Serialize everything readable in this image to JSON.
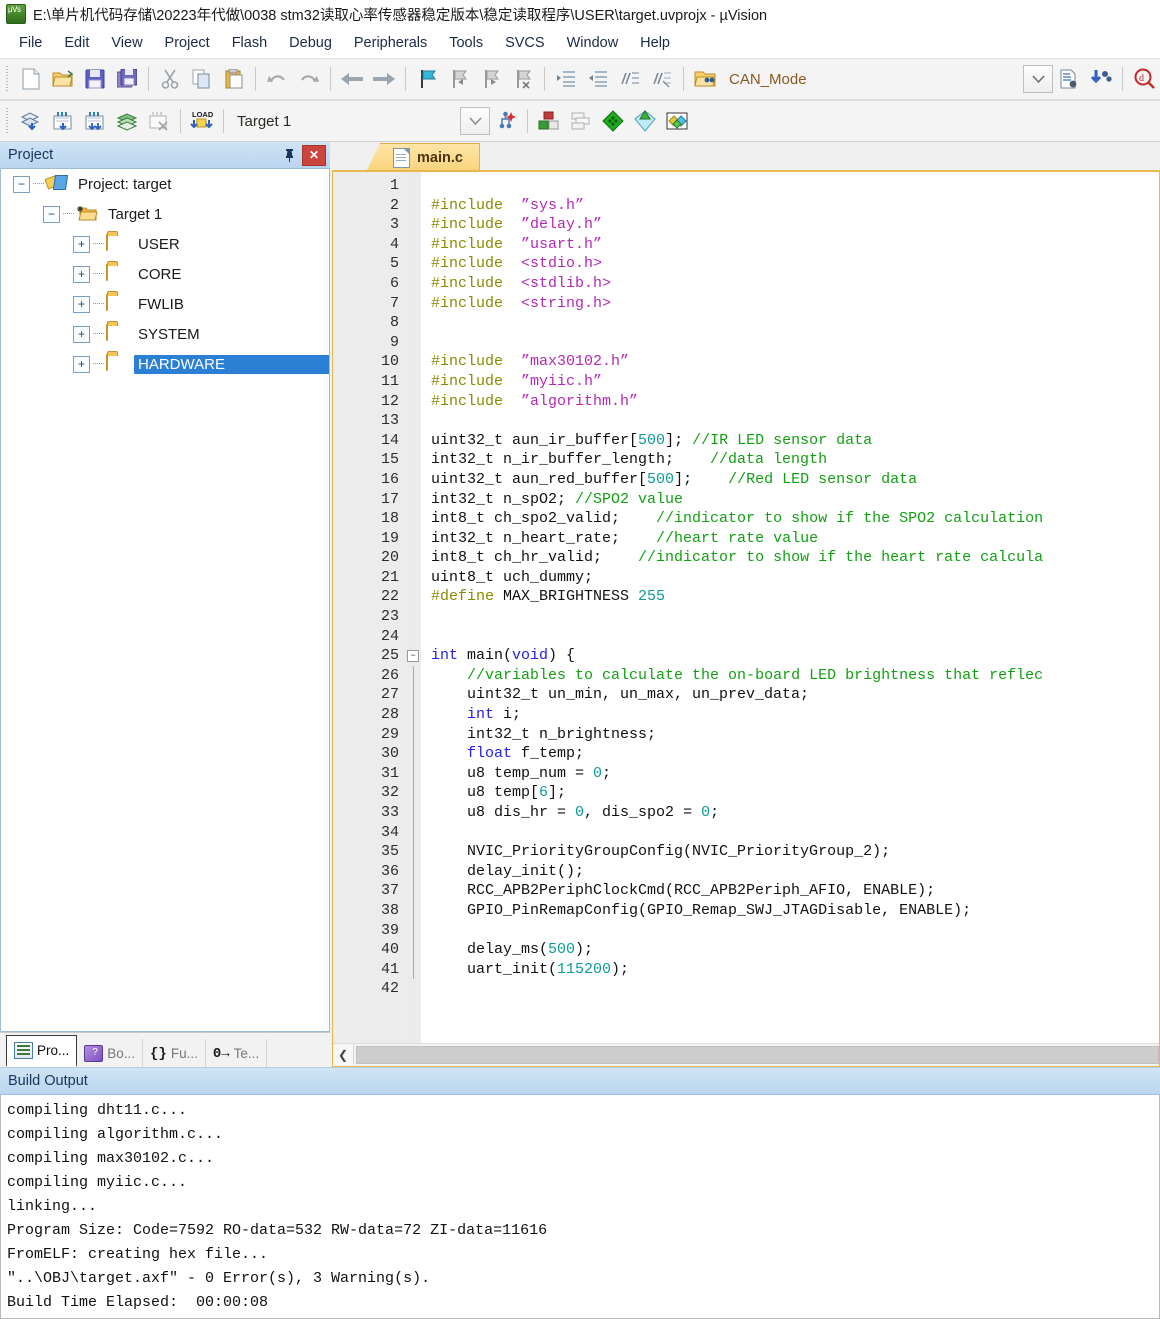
{
  "window": {
    "title": "E:\\单片机代码存储\\20223年代做\\0038 stm32读取心率传感器稳定版本\\稳定读取程序\\USER\\target.uvprojx - µVision",
    "app_icon": "uvision-logo-icon"
  },
  "menubar": {
    "items": [
      "File",
      "Edit",
      "View",
      "Project",
      "Flash",
      "Debug",
      "Peripherals",
      "Tools",
      "SVCS",
      "Window",
      "Help"
    ]
  },
  "toolbar_main": {
    "icons": [
      "new-file-icon",
      "open-file-icon",
      "save-icon",
      "save-all-icon",
      "cut-icon",
      "copy-icon",
      "paste-icon",
      "undo-icon",
      "redo-icon",
      "navigate-back-icon",
      "navigate-forward-icon",
      "bookmark-toggle-icon",
      "bookmark-prev-icon",
      "bookmark-next-icon",
      "bookmark-clear-icon",
      "indent-right-icon",
      "indent-left-icon",
      "comment-icon",
      "uncomment-icon",
      "open-folder-config-icon"
    ],
    "mode_label": "CAN_Mode",
    "right_icons": [
      "dropdown-arrow-icon",
      "file-properties-icon",
      "insert-symbol-icon",
      "find-in-files-icon"
    ]
  },
  "toolbar_build": {
    "icons": [
      "translate-file-icon",
      "build-target-icon",
      "rebuild-all-icon",
      "batch-build-icon",
      "stop-build-icon",
      "download-load-icon"
    ],
    "target_label": "Target 1",
    "right_icons": [
      "target-dropdown-icon",
      "target-options-icon",
      "manage-project-items-icon",
      "multi-project-icon",
      "pack-installer-icon",
      "manage-run-time-env-icon",
      "select-software-packs-icon"
    ]
  },
  "project_panel": {
    "header": "Project",
    "pin_icon": "pin-icon",
    "close_icon": "close-icon",
    "tree": [
      {
        "label": "Project: target",
        "icon": "project-icon",
        "expander": "−",
        "depth": 0,
        "selected": false
      },
      {
        "label": "Target 1",
        "icon": "target-folder-icon",
        "expander": "−",
        "depth": 1,
        "selected": false
      },
      {
        "label": "USER",
        "icon": "folder-icon",
        "expander": "+",
        "depth": 2,
        "selected": false
      },
      {
        "label": "CORE",
        "icon": "folder-icon",
        "expander": "+",
        "depth": 2,
        "selected": false
      },
      {
        "label": "FWLIB",
        "icon": "folder-icon",
        "expander": "+",
        "depth": 2,
        "selected": false
      },
      {
        "label": "SYSTEM",
        "icon": "folder-icon",
        "expander": "+",
        "depth": 2,
        "selected": false
      },
      {
        "label": "HARDWARE",
        "icon": "folder-icon",
        "expander": "+",
        "depth": 2,
        "selected": true
      }
    ],
    "tabs": [
      {
        "label": "Pro...",
        "icon": "project-view-icon",
        "active": true
      },
      {
        "label": "Bo...",
        "icon": "books-view-icon",
        "active": false
      },
      {
        "label": "Fu...",
        "icon": "functions-view-icon",
        "active": false
      },
      {
        "label": "Te...",
        "icon": "templates-view-icon",
        "active": false
      }
    ]
  },
  "editor": {
    "tab": {
      "label": "main.c",
      "icon": "c-file-icon"
    },
    "first_line": 1,
    "fold_markers": {
      "25": "−"
    },
    "lines": [
      {
        "n": 1,
        "tokens": []
      },
      {
        "n": 2,
        "tokens": [
          [
            "pre",
            "#include"
          ],
          [
            "txt",
            "  "
          ],
          [
            "str",
            "”sys.h”"
          ]
        ]
      },
      {
        "n": 3,
        "tokens": [
          [
            "pre",
            "#include"
          ],
          [
            "txt",
            "  "
          ],
          [
            "str",
            "”delay.h”"
          ]
        ]
      },
      {
        "n": 4,
        "tokens": [
          [
            "pre",
            "#include"
          ],
          [
            "txt",
            "  "
          ],
          [
            "str",
            "”usart.h”"
          ]
        ]
      },
      {
        "n": 5,
        "tokens": [
          [
            "pre",
            "#include"
          ],
          [
            "txt",
            "  "
          ],
          [
            "str",
            "<stdio.h>"
          ]
        ]
      },
      {
        "n": 6,
        "tokens": [
          [
            "pre",
            "#include"
          ],
          [
            "txt",
            "  "
          ],
          [
            "str",
            "<stdlib.h>"
          ]
        ]
      },
      {
        "n": 7,
        "tokens": [
          [
            "pre",
            "#include"
          ],
          [
            "txt",
            "  "
          ],
          [
            "str",
            "<string.h>"
          ]
        ]
      },
      {
        "n": 8,
        "tokens": []
      },
      {
        "n": 9,
        "tokens": []
      },
      {
        "n": 10,
        "tokens": [
          [
            "pre",
            "#include"
          ],
          [
            "txt",
            "  "
          ],
          [
            "str",
            "”max30102.h”"
          ]
        ]
      },
      {
        "n": 11,
        "tokens": [
          [
            "pre",
            "#include"
          ],
          [
            "txt",
            "  "
          ],
          [
            "str",
            "”myiic.h”"
          ]
        ]
      },
      {
        "n": 12,
        "tokens": [
          [
            "pre",
            "#include"
          ],
          [
            "txt",
            "  "
          ],
          [
            "str",
            "”algorithm.h”"
          ]
        ]
      },
      {
        "n": 13,
        "tokens": []
      },
      {
        "n": 14,
        "tokens": [
          [
            "txt",
            "uint32_t aun_ir_buffer["
          ],
          [
            "num",
            "500"
          ],
          [
            "txt",
            "]; "
          ],
          [
            "cmt",
            "//IR LED sensor data"
          ]
        ]
      },
      {
        "n": 15,
        "tokens": [
          [
            "txt",
            "int32_t n_ir_buffer_length;    "
          ],
          [
            "cmt",
            "//data length"
          ]
        ]
      },
      {
        "n": 16,
        "tokens": [
          [
            "txt",
            "uint32_t aun_red_buffer["
          ],
          [
            "num",
            "500"
          ],
          [
            "txt",
            "];    "
          ],
          [
            "cmt",
            "//Red LED sensor data"
          ]
        ]
      },
      {
        "n": 17,
        "tokens": [
          [
            "txt",
            "int32_t n_spO2; "
          ],
          [
            "cmt",
            "//SPO2 value"
          ]
        ]
      },
      {
        "n": 18,
        "tokens": [
          [
            "txt",
            "int8_t ch_spo2_valid;    "
          ],
          [
            "cmt",
            "//indicator to show if the SPO2 calculation"
          ]
        ]
      },
      {
        "n": 19,
        "tokens": [
          [
            "txt",
            "int32_t n_heart_rate;    "
          ],
          [
            "cmt",
            "//heart rate value"
          ]
        ]
      },
      {
        "n": 20,
        "tokens": [
          [
            "txt",
            "int8_t ch_hr_valid;    "
          ],
          [
            "cmt",
            "//indicator to show if the heart rate calcula"
          ]
        ]
      },
      {
        "n": 21,
        "tokens": [
          [
            "txt",
            "uint8_t uch_dummy;"
          ]
        ]
      },
      {
        "n": 22,
        "tokens": [
          [
            "pre",
            "#define"
          ],
          [
            "txt",
            " MAX_BRIGHTNESS "
          ],
          [
            "num",
            "255"
          ]
        ]
      },
      {
        "n": 23,
        "tokens": []
      },
      {
        "n": 24,
        "tokens": []
      },
      {
        "n": 25,
        "tokens": [
          [
            "kw",
            "int"
          ],
          [
            "txt",
            " main("
          ],
          [
            "kw",
            "void"
          ],
          [
            "txt",
            ") {"
          ]
        ]
      },
      {
        "n": 26,
        "tokens": [
          [
            "txt",
            "    "
          ],
          [
            "cmt",
            "//variables to calculate the on-board LED brightness that reflec"
          ]
        ]
      },
      {
        "n": 27,
        "tokens": [
          [
            "txt",
            "    uint32_t un_min, un_max, un_prev_data;"
          ]
        ]
      },
      {
        "n": 28,
        "tokens": [
          [
            "txt",
            "    "
          ],
          [
            "kw",
            "int"
          ],
          [
            "txt",
            " i;"
          ]
        ]
      },
      {
        "n": 29,
        "tokens": [
          [
            "txt",
            "    int32_t n_brightness;"
          ]
        ]
      },
      {
        "n": 30,
        "tokens": [
          [
            "txt",
            "    "
          ],
          [
            "kw",
            "float"
          ],
          [
            "txt",
            " f_temp;"
          ]
        ]
      },
      {
        "n": 31,
        "tokens": [
          [
            "txt",
            "    u8 temp_num = "
          ],
          [
            "num",
            "0"
          ],
          [
            "txt",
            ";"
          ]
        ]
      },
      {
        "n": 32,
        "tokens": [
          [
            "txt",
            "    u8 temp["
          ],
          [
            "num",
            "6"
          ],
          [
            "txt",
            "];"
          ]
        ]
      },
      {
        "n": 33,
        "tokens": [
          [
            "txt",
            "    u8 dis_hr = "
          ],
          [
            "num",
            "0"
          ],
          [
            "txt",
            ", dis_spo2 = "
          ],
          [
            "num",
            "0"
          ],
          [
            "txt",
            ";"
          ]
        ]
      },
      {
        "n": 34,
        "tokens": []
      },
      {
        "n": 35,
        "tokens": [
          [
            "txt",
            "    NVIC_PriorityGroupConfig(NVIC_PriorityGroup_2);"
          ]
        ]
      },
      {
        "n": 36,
        "tokens": [
          [
            "txt",
            "    delay_init();"
          ]
        ]
      },
      {
        "n": 37,
        "tokens": [
          [
            "txt",
            "    RCC_APB2PeriphClockCmd(RCC_APB2Periph_AFIO, ENABLE);"
          ]
        ]
      },
      {
        "n": 38,
        "tokens": [
          [
            "txt",
            "    GPIO_PinRemapConfig(GPIO_Remap_SWJ_JTAGDisable, ENABLE);"
          ]
        ]
      },
      {
        "n": 39,
        "tokens": []
      },
      {
        "n": 40,
        "tokens": [
          [
            "txt",
            "    delay_ms("
          ],
          [
            "num",
            "500"
          ],
          [
            "txt",
            ");"
          ]
        ]
      },
      {
        "n": 41,
        "tokens": [
          [
            "txt",
            "    uart_init("
          ],
          [
            "num",
            "115200"
          ],
          [
            "txt",
            ");"
          ]
        ]
      },
      {
        "n": 42,
        "tokens": []
      }
    ],
    "hscroll": {
      "left_arrow": "scroll-left-icon"
    }
  },
  "build_output": {
    "header": "Build Output",
    "lines": [
      "compiling dht11.c...",
      "compiling algorithm.c...",
      "compiling max30102.c...",
      "compiling myiic.c...",
      "linking...",
      "Program Size: Code=7592 RO-data=532 RW-data=72 ZI-data=11616",
      "FromELF: creating hex file...",
      "\"..\\OBJ\\target.axf\" - 0 Error(s), 3 Warning(s).",
      "Build Time Elapsed:  00:00:08"
    ]
  },
  "colors": {
    "selection_blue": "#2b7fd4",
    "panel_header": "#c3dcf0",
    "tab_amber": "#fbd37a",
    "comment_green": "#11a011",
    "string_magenta": "#b528b5",
    "number_teal": "#0f9a9a",
    "keyword_blue": "#2121e0",
    "preproc_olive": "#8a8a00"
  }
}
